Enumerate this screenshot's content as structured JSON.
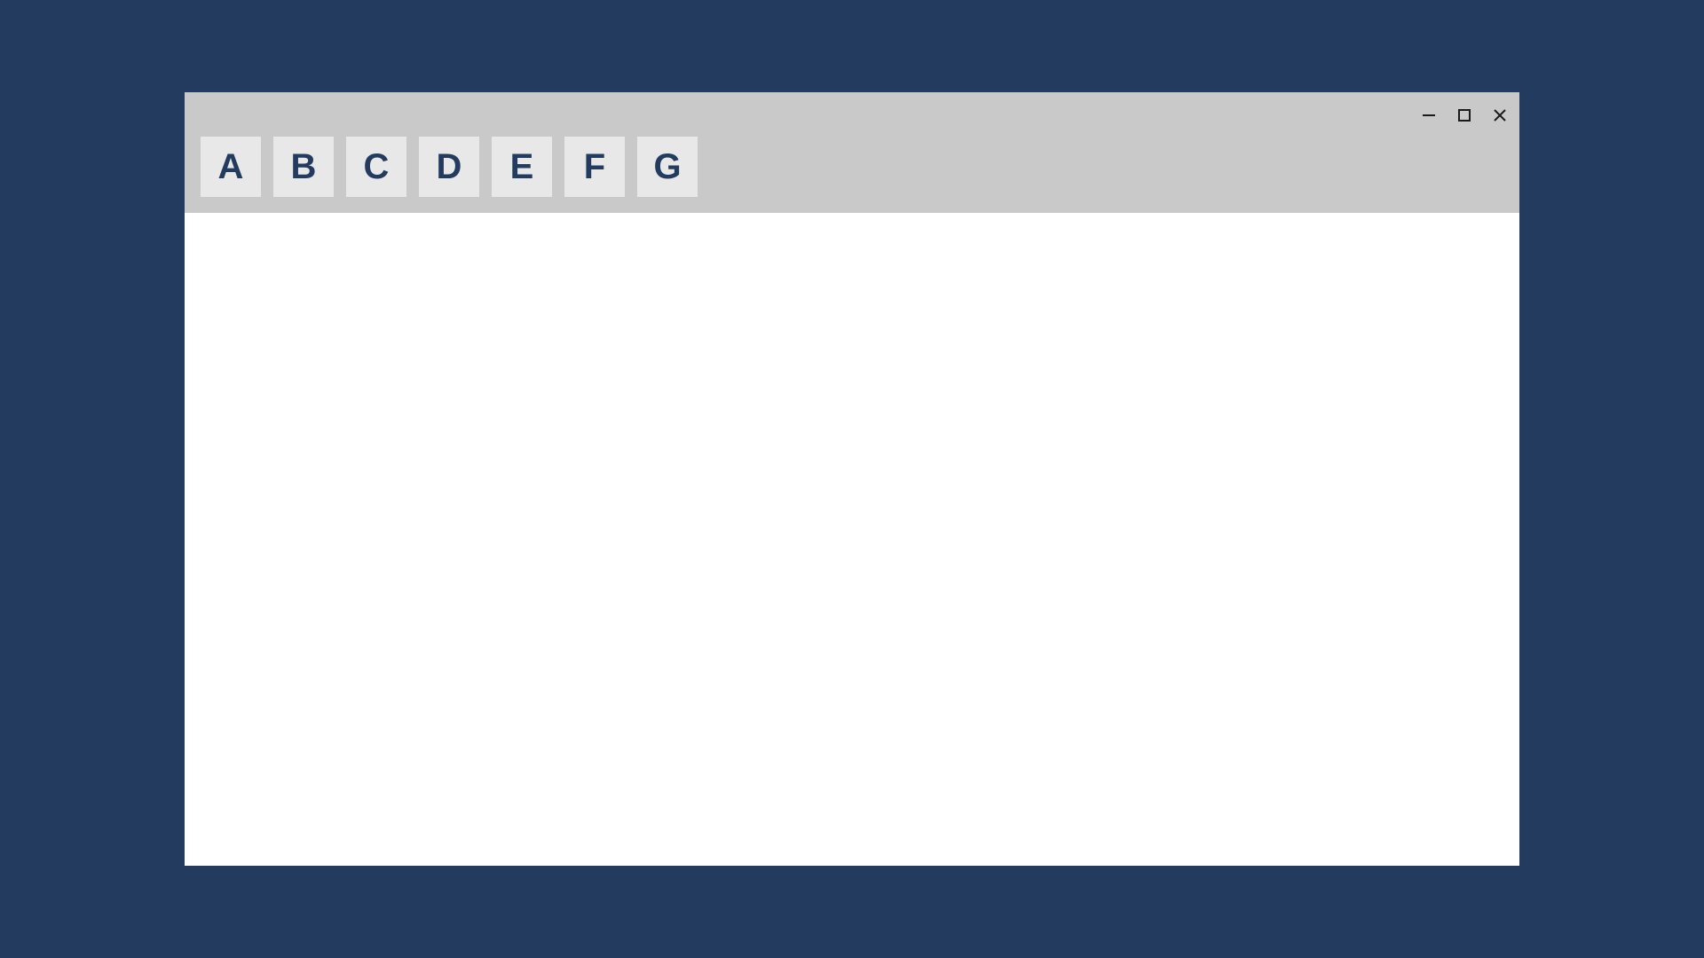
{
  "toolbar": {
    "buttons": [
      {
        "label": "A"
      },
      {
        "label": "B"
      },
      {
        "label": "C"
      },
      {
        "label": "D"
      },
      {
        "label": "E"
      },
      {
        "label": "F"
      },
      {
        "label": "G"
      }
    ]
  }
}
